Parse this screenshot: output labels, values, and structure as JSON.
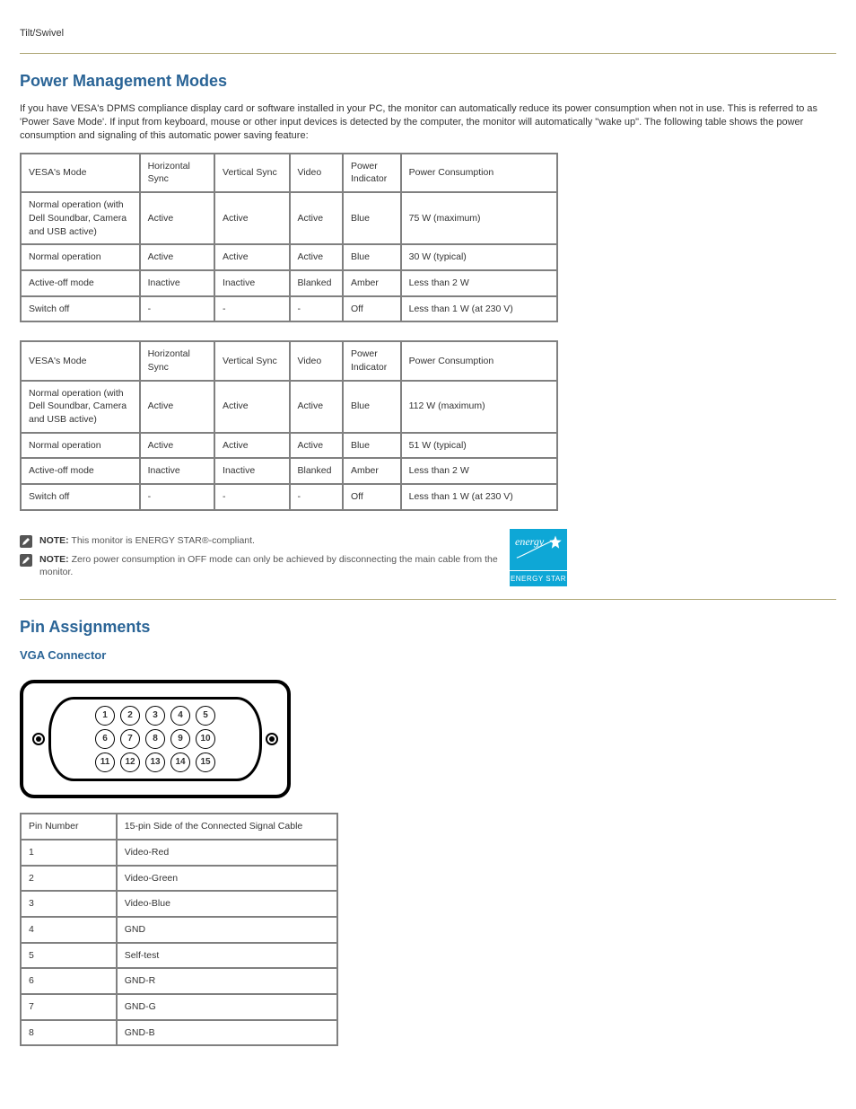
{
  "top_caption": "Tilt/Swivel",
  "section1": {
    "title": "Power Management Modes",
    "para1": "If you have VESA's DPMS compliance display card or software installed in your PC, the monitor can automatically reduce its power consumption when not in use. This is referred to as 'Power Save Mode'. If input from keyboard, mouse or other input devices is detected by the computer, the monitor will automatically \"wake up\". The following table shows the power consumption and signaling of this automatic power saving feature:",
    "table1": {
      "headers": [
        "VESA's Mode",
        "Horizontal Sync",
        "Vertical Sync",
        "Video",
        "Power Indicator",
        "Power Consumption"
      ],
      "rows": [
        [
          "Normal operation (with Dell Soundbar, Camera and USB active)",
          "Active",
          "Active",
          "Active",
          "Blue",
          "75 W (maximum)"
        ],
        [
          "Normal operation",
          "Active",
          "Active",
          "Active",
          "Blue",
          "30 W (typical)"
        ],
        [
          "Active-off mode",
          "Inactive",
          "Inactive",
          "Blanked",
          "Amber",
          "Less than 2 W"
        ],
        [
          "Switch off",
          "-",
          "-",
          "-",
          "Off",
          "Less than 1 W (at 230 V)"
        ]
      ]
    },
    "table2": {
      "headers": [
        "VESA's Mode",
        "Horizontal Sync",
        "Vertical Sync",
        "Video",
        "Power Indicator",
        "Power Consumption"
      ],
      "rows": [
        [
          "Normal operation (with Dell Soundbar, Camera and USB active)",
          "Active",
          "Active",
          "Active",
          "Blue",
          "112 W (maximum)"
        ],
        [
          "Normal operation",
          "Active",
          "Active",
          "Active",
          "Blue",
          "51 W (typical)"
        ],
        [
          "Active-off mode",
          "Inactive",
          "Inactive",
          "Blanked",
          "Amber",
          "Less than 2 W"
        ],
        [
          "Switch off",
          "-",
          "-",
          "-",
          "Off",
          "Less than 1 W (at 230 V)"
        ]
      ]
    },
    "note1": {
      "bold": "NOTE:",
      "text": "This monitor is ENERGY STAR®-compliant."
    },
    "note2": {
      "bold": "NOTE:",
      "text": "Zero power consumption in OFF mode can only be achieved by disconnecting the main cable from the monitor."
    },
    "energystar_label": "ENERGY STAR"
  },
  "section2": {
    "title": "Pin Assignments",
    "subtitle": "VGA Connector",
    "pins": [
      "1",
      "2",
      "3",
      "4",
      "5",
      "6",
      "7",
      "8",
      "9",
      "10",
      "11",
      "12",
      "13",
      "14",
      "15"
    ],
    "table": {
      "headers": [
        "Pin Number",
        "15-pin Side of the Connected Signal Cable"
      ],
      "rows": [
        [
          "1",
          "Video-Red"
        ],
        [
          "2",
          "Video-Green"
        ],
        [
          "3",
          "Video-Blue"
        ],
        [
          "4",
          "GND"
        ],
        [
          "5",
          "Self-test"
        ],
        [
          "6",
          "GND-R"
        ],
        [
          "7",
          "GND-G"
        ],
        [
          "8",
          "GND-B"
        ]
      ]
    }
  }
}
